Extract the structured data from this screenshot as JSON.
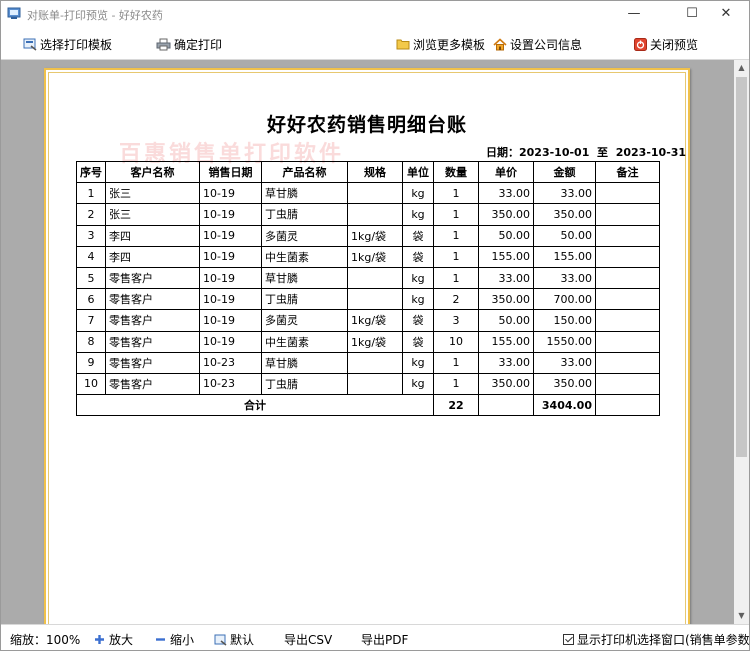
{
  "window": {
    "title": "对账单-打印预览 - 好好农药"
  },
  "toolbar": {
    "select_template": "选择打印模板",
    "confirm_print": "确定打印",
    "browse_templates": "浏览更多模板",
    "company_settings": "设置公司信息",
    "close_preview": "关闭预览"
  },
  "document": {
    "title": "好好农药销售明细台账",
    "watermark": "百惠销售单打印软件",
    "date_label": "日期：",
    "date_from": "2023-10-01",
    "date_sep": "至",
    "date_to": "2023-10-31",
    "columns": [
      "序号",
      "客户名称",
      "销售日期",
      "产品名称",
      "规格",
      "单位",
      "数量",
      "单价",
      "金额",
      "备注"
    ],
    "rows": [
      [
        "1",
        "张三",
        "10-19",
        "草甘膦",
        "",
        "kg",
        "1",
        "33.00",
        "33.00",
        ""
      ],
      [
        "2",
        "张三",
        "10-19",
        "丁虫腈",
        "",
        "kg",
        "1",
        "350.00",
        "350.00",
        ""
      ],
      [
        "3",
        "李四",
        "10-19",
        "多菌灵",
        "1kg/袋",
        "袋",
        "1",
        "50.00",
        "50.00",
        ""
      ],
      [
        "4",
        "李四",
        "10-19",
        "中生菌素",
        "1kg/袋",
        "袋",
        "1",
        "155.00",
        "155.00",
        ""
      ],
      [
        "5",
        "零售客户",
        "10-19",
        "草甘膦",
        "",
        "kg",
        "1",
        "33.00",
        "33.00",
        ""
      ],
      [
        "6",
        "零售客户",
        "10-19",
        "丁虫腈",
        "",
        "kg",
        "2",
        "350.00",
        "700.00",
        ""
      ],
      [
        "7",
        "零售客户",
        "10-19",
        "多菌灵",
        "1kg/袋",
        "袋",
        "3",
        "50.00",
        "150.00",
        ""
      ],
      [
        "8",
        "零售客户",
        "10-19",
        "中生菌素",
        "1kg/袋",
        "袋",
        "10",
        "155.00",
        "1550.00",
        ""
      ],
      [
        "9",
        "零售客户",
        "10-23",
        "草甘膦",
        "",
        "kg",
        "1",
        "33.00",
        "33.00",
        ""
      ],
      [
        "10",
        "零售客户",
        "10-23",
        "丁虫腈",
        "",
        "kg",
        "1",
        "350.00",
        "350.00",
        ""
      ]
    ],
    "total_label": "合计",
    "total_qty": "22",
    "total_amount": "3404.00"
  },
  "statusbar": {
    "zoom_label": "缩放：100%",
    "zoom_in": "放大",
    "zoom_out": "缩小",
    "default": "默认",
    "export_csv": "导出CSV",
    "export_pdf": "导出PDF",
    "show_printer_dialog": "显示打印机选择窗口(销售单参数)",
    "show_printer_dialog_checked": true
  },
  "colors": {
    "paper_border": "#f0c14a",
    "preview_bg": "#ababab",
    "watermark": "#e65a5a"
  }
}
